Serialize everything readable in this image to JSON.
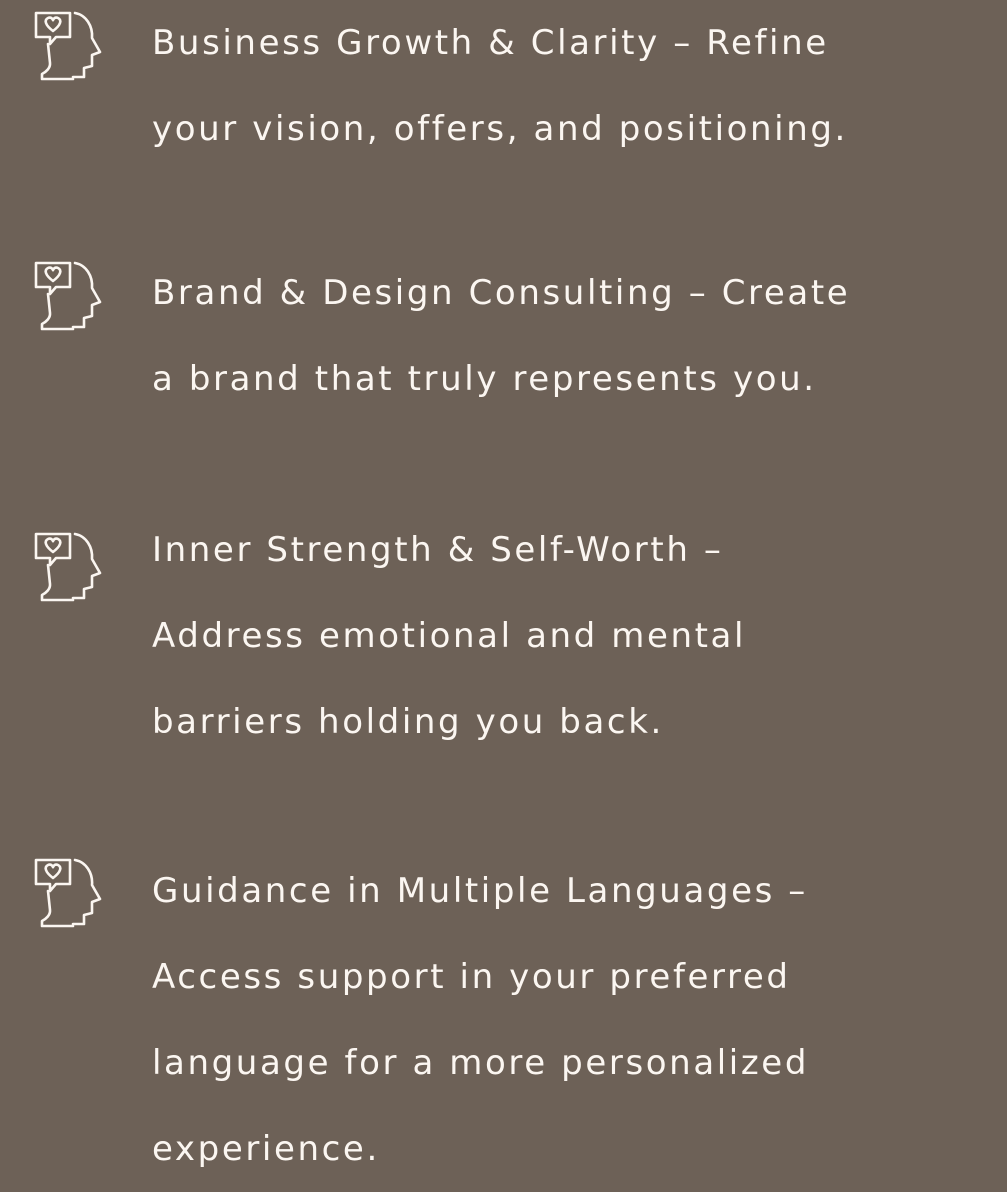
{
  "colors": {
    "background": "#6d6157",
    "text": "#fbf6f1",
    "icon_stroke": "#fbf6f1"
  },
  "items": [
    {
      "icon": "head-heart-icon",
      "text": "Business Growth & Clarity – Refine\nyour vision, offers, and positioning."
    },
    {
      "icon": "head-heart-icon",
      "text": "Brand & Design Consulting – Create\na brand that truly represents you."
    },
    {
      "icon": "head-heart-icon",
      "text": "Inner Strength & Self-Worth –\nAddress emotional and mental\nbarriers holding you back."
    },
    {
      "icon": "head-heart-icon",
      "text": "Guidance in Multiple Languages –\nAccess support in your preferred\nlanguage for a more personalized\nexperience."
    }
  ]
}
